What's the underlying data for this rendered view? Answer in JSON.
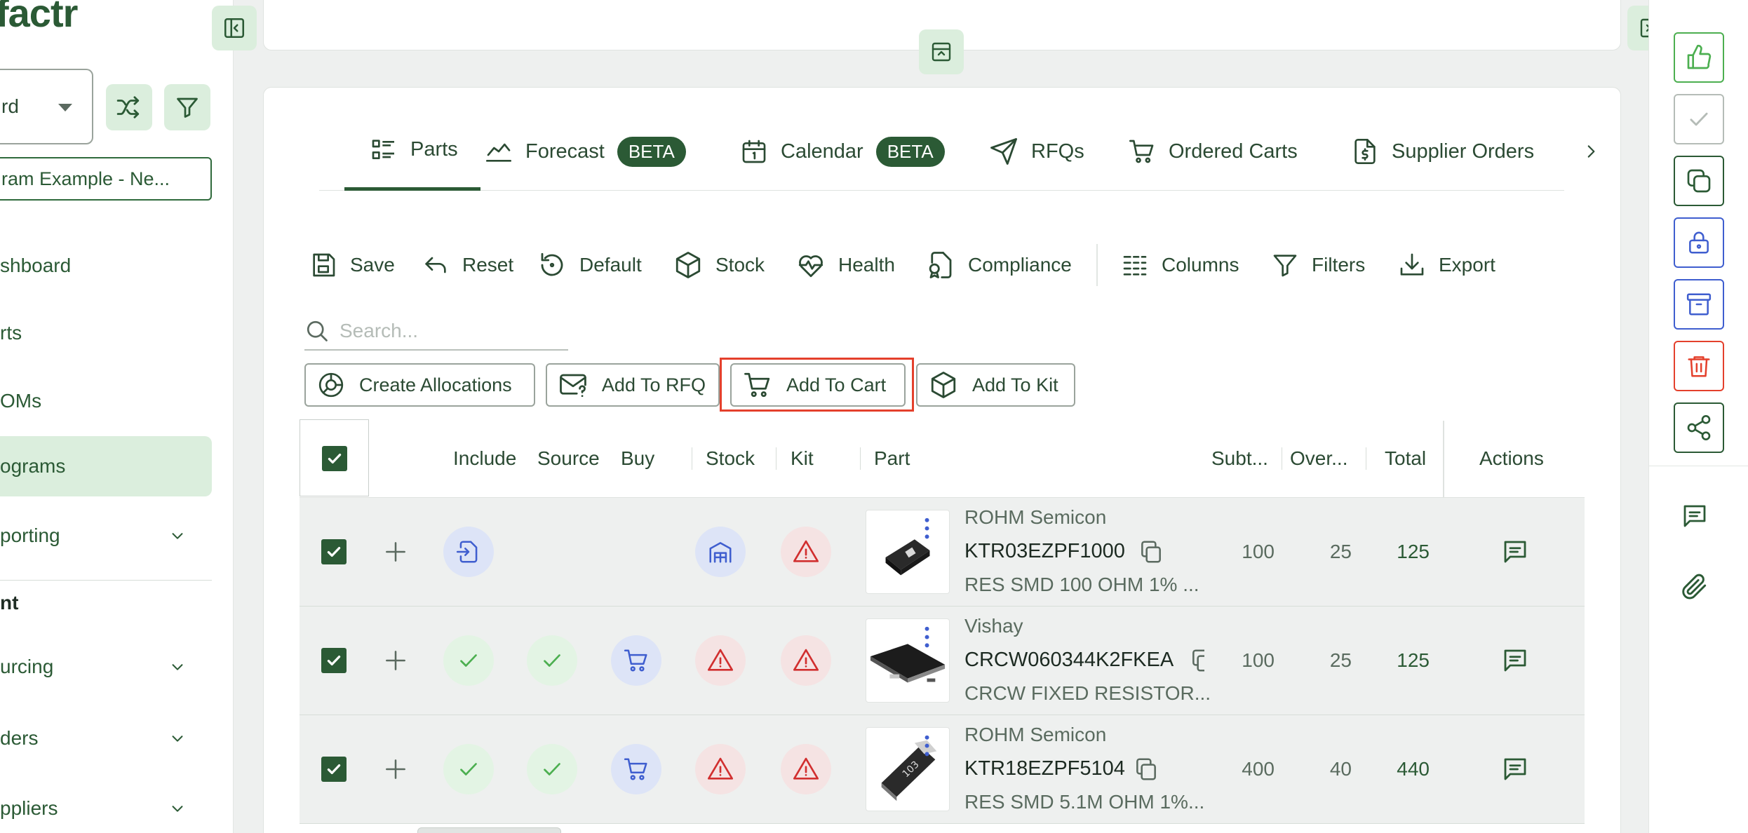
{
  "sidebar": {
    "logo": "factr",
    "workspace_select": "rd",
    "program": "ram Example - Ne...",
    "nav": [
      {
        "label": "shboard"
      },
      {
        "label": "rts"
      },
      {
        "label": "OMs"
      },
      {
        "label": "ograms",
        "active": true
      },
      {
        "label": "porting"
      }
    ],
    "section_label": "nt",
    "nav2": [
      {
        "label": "urcing"
      },
      {
        "label": "ders"
      },
      {
        "label": "ppliers"
      }
    ]
  },
  "tabs": [
    {
      "label": "Parts",
      "icon": "list-icon",
      "active": true
    },
    {
      "label": "Forecast",
      "icon": "chart-line-icon",
      "badge": "BETA"
    },
    {
      "label": "Calendar",
      "icon": "calendar-icon",
      "badge": "BETA"
    },
    {
      "label": "RFQs",
      "icon": "send-icon"
    },
    {
      "label": "Ordered Carts",
      "icon": "cart-icon"
    },
    {
      "label": "Supplier Orders",
      "icon": "file-dollar-icon"
    }
  ],
  "toolbar": {
    "save": "Save",
    "reset": "Reset",
    "default": "Default",
    "stock": "Stock",
    "health": "Health",
    "compliance": "Compliance",
    "columns": "Columns",
    "filters": "Filters",
    "export": "Export"
  },
  "search": {
    "placeholder": "Search..."
  },
  "actions": {
    "create_allocations": "Create Allocations",
    "add_to_rfq": "Add To RFQ",
    "add_to_cart": "Add To Cart",
    "add_to_kit": "Add To Kit"
  },
  "table": {
    "headers": {
      "include": "Include",
      "source": "Source",
      "buy": "Buy",
      "stock": "Stock",
      "kit": "Kit",
      "part": "Part",
      "subtotal": "Subt...",
      "overage": "Over...",
      "total": "Total",
      "actions": "Actions"
    },
    "rows": [
      {
        "manufacturer": "ROHM Semicon",
        "part_number": "KTR03EZPF1000",
        "description": "RES SMD 100 OHM 1% ...",
        "subtotal": "100",
        "overage": "25",
        "total": "125",
        "include": "import",
        "source": "none",
        "buy": "none",
        "stock": "warehouse",
        "kit": "warning"
      },
      {
        "manufacturer": "Vishay",
        "part_number": "CRCW060344K2FKEA",
        "description": "CRCW FIXED RESISTOR...",
        "subtotal": "100",
        "overage": "25",
        "total": "125",
        "include": "check",
        "source": "check",
        "buy": "cart",
        "stock": "warning",
        "kit": "warning"
      },
      {
        "manufacturer": "ROHM Semicon",
        "part_number": "KTR18EZPF5104",
        "description": "RES SMD 5.1M OHM 1%...",
        "subtotal": "400",
        "overage": "40",
        "total": "440",
        "include": "check",
        "source": "check",
        "buy": "cart",
        "stock": "warning",
        "kit": "warning"
      }
    ]
  },
  "colors": {
    "brand": "#2b5a35",
    "accent_light": "#dbeedd",
    "danger": "#e4402c",
    "info": "#3f5ecf"
  }
}
